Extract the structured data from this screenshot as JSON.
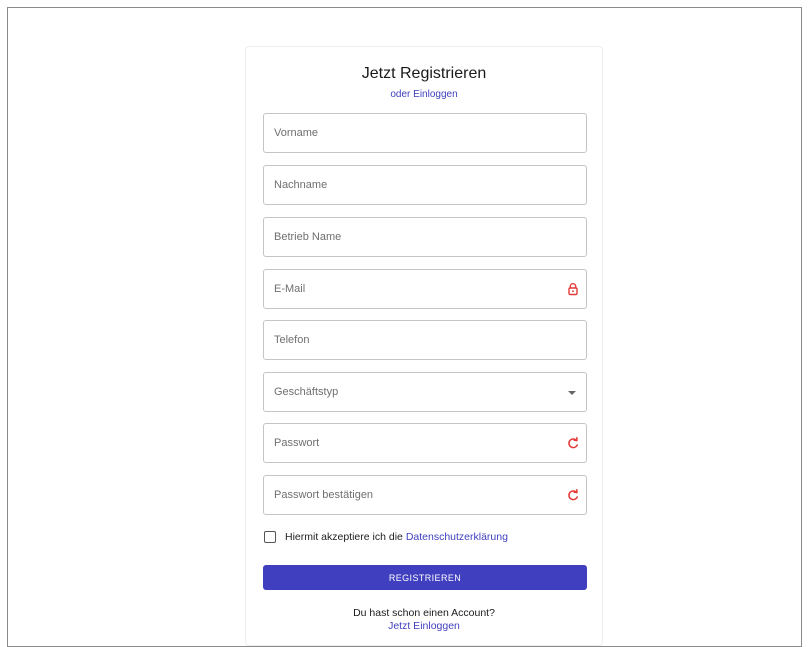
{
  "header": {
    "title": "Jetzt Registrieren",
    "login_link": "oder Einloggen"
  },
  "form": {
    "fields": [
      {
        "placeholder": "Vorname",
        "icon": null
      },
      {
        "placeholder": "Nachname",
        "icon": null
      },
      {
        "placeholder": "Betrieb Name",
        "icon": null
      },
      {
        "placeholder": "E-Mail",
        "icon": "lock-icon"
      },
      {
        "placeholder": "Telefon",
        "icon": null
      },
      {
        "placeholder": "Geschäftstyp",
        "icon": "chevron-down-icon"
      },
      {
        "placeholder": "Passwort",
        "icon": "refresh-icon"
      },
      {
        "placeholder": "Passwort bestätigen",
        "icon": "refresh-icon"
      }
    ],
    "agree_text": "Hiermit akzeptiere ich die",
    "agree_link": "Datenschutzerklärung",
    "submit_label": "REGISTRIEREN"
  },
  "footer": {
    "have_account": "Du hast schon einen Account?",
    "login_link": "Jetzt Einloggen"
  },
  "colors": {
    "accent": "#3f3fbf",
    "icon_red": "#e53935",
    "border": "#c4c4c4"
  }
}
